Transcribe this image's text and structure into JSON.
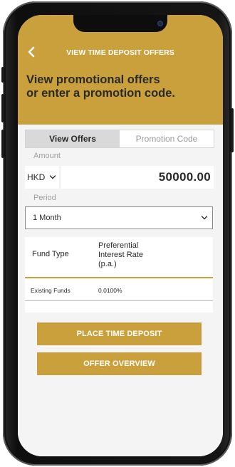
{
  "colors": {
    "accent": "#c9a03c",
    "text": "#2a2a2a",
    "muted": "#9e9e9e",
    "background": "#f4f4f4"
  },
  "header": {
    "back_icon": "chevron-left-icon",
    "title": "VIEW TIME DEPOSIT OFFERS",
    "headline_line1": "View promotional offers",
    "headline_line2": "or enter a promotion code."
  },
  "tabs": [
    {
      "label": "View Offers",
      "active": true
    },
    {
      "label": "Promotion Code",
      "active": false
    }
  ],
  "amount": {
    "label": "Amount",
    "currency": "HKD",
    "value": "50000.00"
  },
  "period": {
    "label": "Period",
    "selected": "1 Month"
  },
  "rate_table": {
    "headers": {
      "fund_type": "Fund Type",
      "rate_line1": "Preferential",
      "rate_line2": "Interest Rate",
      "rate_line3": "(p.a.)"
    },
    "rows": [
      {
        "fund_type": "Existing Funds",
        "rate": "0.0100%"
      }
    ]
  },
  "buttons": {
    "place": "PLACE TIME DEPOSIT",
    "overview": "OFFER OVERVIEW"
  }
}
